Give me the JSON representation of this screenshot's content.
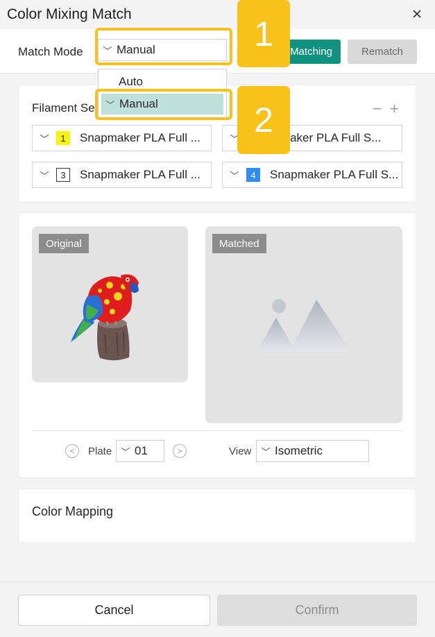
{
  "window": {
    "title": "Color Mixing Match",
    "close_icon": "close-icon"
  },
  "match_mode": {
    "label": "Match Mode",
    "value": "Manual",
    "options": [
      "Auto",
      "Manual"
    ],
    "selected_option": "Manual"
  },
  "toolbar": {
    "matching_label": "Matching",
    "rematch_label": "Rematch"
  },
  "filament": {
    "title": "Filament Se",
    "minus": "−",
    "plus": "+",
    "slots": [
      {
        "number": "1",
        "name": "Snapmaker PLA Full ...",
        "color": "#f4f40d"
      },
      {
        "number": "",
        "name": "apmaker PLA Full S...",
        "color": "#ffffff"
      },
      {
        "number": "3",
        "name": "Snapmaker PLA Full ...",
        "color": "#ffffff"
      },
      {
        "number": "4",
        "name": "Snapmaker PLA Full S...",
        "color": "#2f8cf0"
      }
    ]
  },
  "preview": {
    "original_label": "Original",
    "matched_label": "Matched",
    "plate_label": "Plate",
    "plate_value": "01",
    "view_label": "View",
    "view_value": "Isometric"
  },
  "color_mapping": {
    "title": "Color Mapping"
  },
  "footer": {
    "cancel_label": "Cancel",
    "confirm_label": "Confirm"
  },
  "annotations": {
    "badge_1": "1",
    "badge_2": "2",
    "highlight_color": "#f8c21a"
  }
}
